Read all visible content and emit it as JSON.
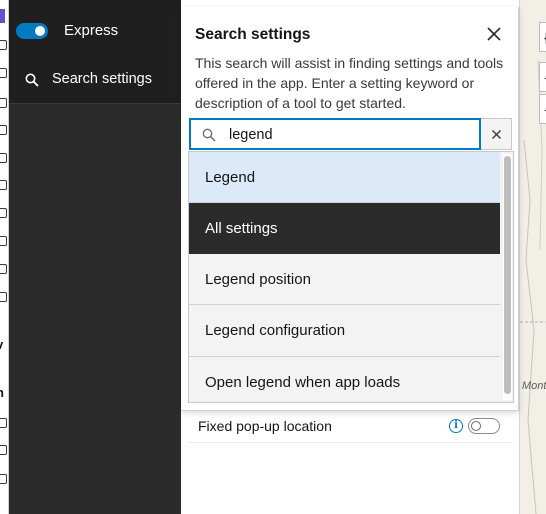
{
  "nav": {
    "express_label": "Express",
    "search_label": "Search settings",
    "edge_letters": [
      "v",
      "n"
    ]
  },
  "dialog": {
    "title": "Search settings",
    "description": "This search will assist in finding settings and tools offered in the app. Enter a setting keyword or description of a tool to get started.",
    "search_value": "legend",
    "suggestions": [
      {
        "label": "Legend",
        "state": "active"
      },
      {
        "label": "All settings",
        "state": "dark"
      },
      {
        "label": "Legend position",
        "state": "normal"
      },
      {
        "label": "Legend configuration",
        "state": "normal"
      },
      {
        "label": "Open legend when app loads",
        "state": "normal"
      }
    ]
  },
  "background_settings": {
    "popup_label": "Fixed pop-up location",
    "info_icon_glyph": "i",
    "popup_toggle_on": false
  },
  "map": {
    "label_fragment": "Monta",
    "button_glyphs": [
      "{",
      "-",
      "-"
    ]
  },
  "colors": {
    "accent": "#007ac2",
    "nav_dark": "#2b2b2b",
    "highlight": "#dbe9f8"
  }
}
